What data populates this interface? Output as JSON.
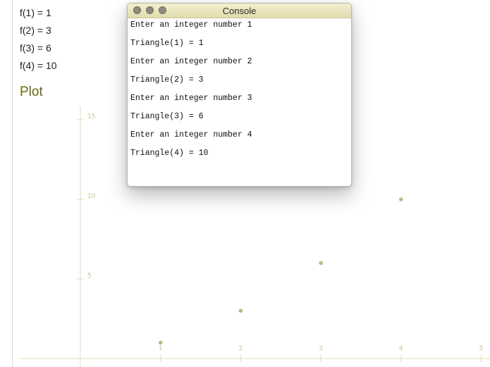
{
  "results": [
    {
      "text": "f(1) = 1"
    },
    {
      "text": "f(2) = 3"
    },
    {
      "text": "f(3) = 6"
    },
    {
      "text": "f(4) = 10"
    }
  ],
  "plot": {
    "heading": "Plot"
  },
  "console": {
    "title": "Console",
    "lines": [
      "Enter an integer number 1",
      "Triangle(1) = 1",
      "Enter an integer number 2",
      "Triangle(2) = 3",
      "Enter an integer number 3",
      "Triangle(3) = 6",
      "Enter an integer number 4",
      "Triangle(4) = 10"
    ]
  },
  "colors": {
    "axis": "#e0dcb4",
    "tick_label": "#c8c090",
    "point": "#c4b48c",
    "heading": "#6a6a14"
  },
  "chart_data": {
    "type": "scatter",
    "x": [
      1,
      2,
      3,
      4
    ],
    "y": [
      1,
      3,
      6,
      10
    ],
    "xticks": [
      "1",
      "2",
      "3",
      "4",
      "5"
    ],
    "yticks": [
      "5",
      "10",
      "15"
    ],
    "xlim": [
      0,
      5
    ],
    "ylim": [
      0,
      15.5
    ],
    "title": "",
    "xlabel": "",
    "ylabel": ""
  }
}
